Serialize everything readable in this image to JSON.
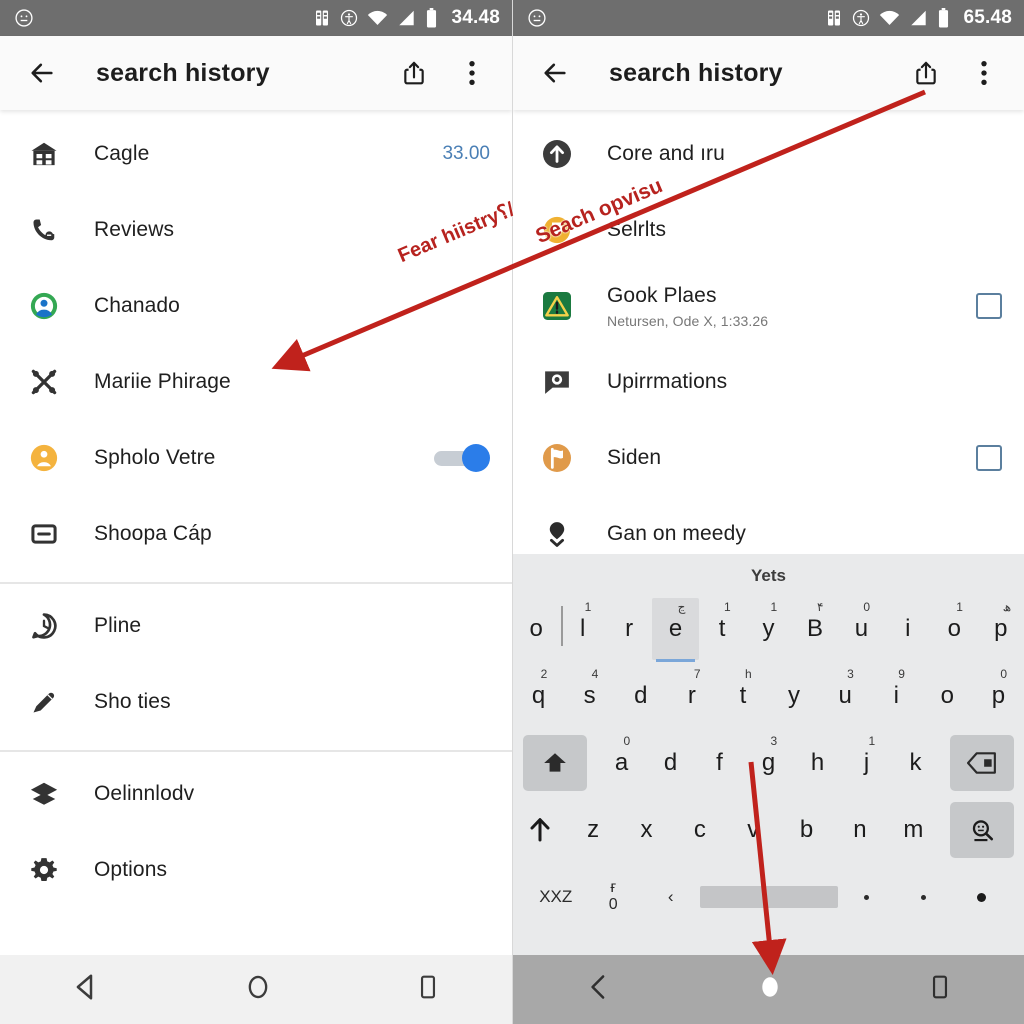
{
  "left": {
    "statusbar": {
      "clock": "34.48",
      "icons": [
        "face-icon",
        "sim-icon",
        "accessibility-icon",
        "wifi-icon",
        "signal-icon",
        "battery-icon"
      ]
    },
    "appbar": {
      "back": "back-arrow-icon",
      "title": "search history",
      "share": "share-icon",
      "overflow": "more-vert-icon"
    },
    "rows": [
      {
        "icon": "home-store-icon",
        "label": "Cagle",
        "trail": "33.00"
      },
      {
        "icon": "phone-callback-icon",
        "label": "Reviews",
        "trail": ""
      },
      {
        "icon": "account-circle-icon",
        "label": "Chanado",
        "trail": ""
      },
      {
        "icon": "cutlery-icon",
        "label": "Mariie Phirage",
        "trail": ""
      },
      {
        "icon": "person-pin-icon",
        "label": "Spholo Vetre",
        "trail": "",
        "toggle": true
      },
      {
        "icon": "remove-box-icon",
        "label": "Shoopa Cáp",
        "trail": ""
      }
    ],
    "rows2": [
      {
        "icon": "clock-badge-icon",
        "label": "Pline",
        "trail": ""
      },
      {
        "icon": "pen-icon",
        "label": "Sho ties",
        "trail": ""
      }
    ],
    "rows3": [
      {
        "icon": "layers-icon",
        "label": "Oelinnlodv",
        "trail": ""
      },
      {
        "icon": "gear-icon",
        "label": "Options",
        "trail": ""
      }
    ],
    "navbar": {
      "back": "nav-back-icon",
      "home": "nav-home-icon",
      "recents": "nav-recents-icon"
    }
  },
  "right": {
    "statusbar": {
      "clock": "65.48"
    },
    "appbar": {
      "back": "back-arrow-icon",
      "title": "search history",
      "share": "share-icon",
      "overflow": "more-vert-icon"
    },
    "rows": [
      {
        "icon": "arrow-up-circle-icon",
        "label": "Core and ıru",
        "sub": "",
        "checkbox": false
      },
      {
        "icon": "badge-circle-icon",
        "label": "Selrlts",
        "sub": "",
        "checkbox": false
      },
      {
        "icon": "warning-app-icon",
        "label": "Gook Plaes",
        "sub": "Netursen, Ode X, 1:33.26",
        "checkbox": true
      },
      {
        "icon": "chat-photo-icon",
        "label": "Upirrmations",
        "sub": "",
        "checkbox": false
      },
      {
        "icon": "flag-circle-icon",
        "label": "Siden",
        "sub": "",
        "checkbox": true
      },
      {
        "icon": "pin-down-icon",
        "label": "Gan on meedy",
        "sub": "",
        "checkbox": false
      }
    ],
    "keyboard": {
      "suggestion": "Yets",
      "row1": [
        {
          "key": "o",
          "sup": "",
          "caret": false
        },
        {
          "key": "l",
          "sup": "1",
          "caret": true
        },
        {
          "key": "r",
          "sup": "",
          "caret": false
        },
        {
          "key": "e",
          "sup": "ڃ",
          "active": true
        },
        {
          "key": "t",
          "sup": "1",
          "caret": false
        },
        {
          "key": "y",
          "sup": "1",
          "caret": false
        },
        {
          "key": "B",
          "sup": "۴",
          "caret": false
        },
        {
          "key": "u",
          "sup": "0",
          "caret": false
        },
        {
          "key": "i",
          "sup": "",
          "caret": false
        },
        {
          "key": "o",
          "sup": "1",
          "caret": false
        },
        {
          "key": "p",
          "sup": "ھ",
          "caret": false
        }
      ],
      "row2": [
        {
          "key": "q",
          "sup": "2"
        },
        {
          "key": "s",
          "sup": "4"
        },
        {
          "key": "d",
          "sup": ""
        },
        {
          "key": "r",
          "sup": "7"
        },
        {
          "key": "t",
          "sup": "һ"
        },
        {
          "key": "y",
          "sup": ""
        },
        {
          "key": "u",
          "sup": "3"
        },
        {
          "key": "i",
          "sup": "9"
        },
        {
          "key": "o",
          "sup": ""
        },
        {
          "key": "p",
          "sup": "0"
        }
      ],
      "row3_left": "shift-filled-icon",
      "row3": [
        {
          "key": "a",
          "sup": "0"
        },
        {
          "key": "d",
          "sup": ""
        },
        {
          "key": "f",
          "sup": ""
        },
        {
          "key": "g",
          "sup": "3"
        },
        {
          "key": "h",
          "sup": ""
        },
        {
          "key": "j",
          "sup": "1"
        },
        {
          "key": "k",
          "sup": ""
        }
      ],
      "row3_right": "backspace-icon",
      "row4_left": "shift-arrow-icon",
      "row4": [
        {
          "key": "z"
        },
        {
          "key": "x"
        },
        {
          "key": "c"
        },
        {
          "key": "v"
        },
        {
          "key": "b"
        },
        {
          "key": "n"
        },
        {
          "key": "m"
        }
      ],
      "row4_right": "emoji-search-icon",
      "row5": {
        "symbols": "XXZ",
        "stack_top": "ғ",
        "stack_bottom": "0",
        "chevron": "‹",
        "space": "space-bar",
        "dot1": "period-small",
        "dot2": "period-small",
        "dot3": "period-large"
      }
    },
    "navbar": {
      "back": "nav-back-icon",
      "home": "nav-home-icon",
      "recents": "nav-recents-icon"
    }
  },
  "annotations": {
    "arrow1_label_a": "Fear hiistry؟/",
    "arrow1_label_b": "Seach opvisu",
    "accent": "#b7231f"
  }
}
